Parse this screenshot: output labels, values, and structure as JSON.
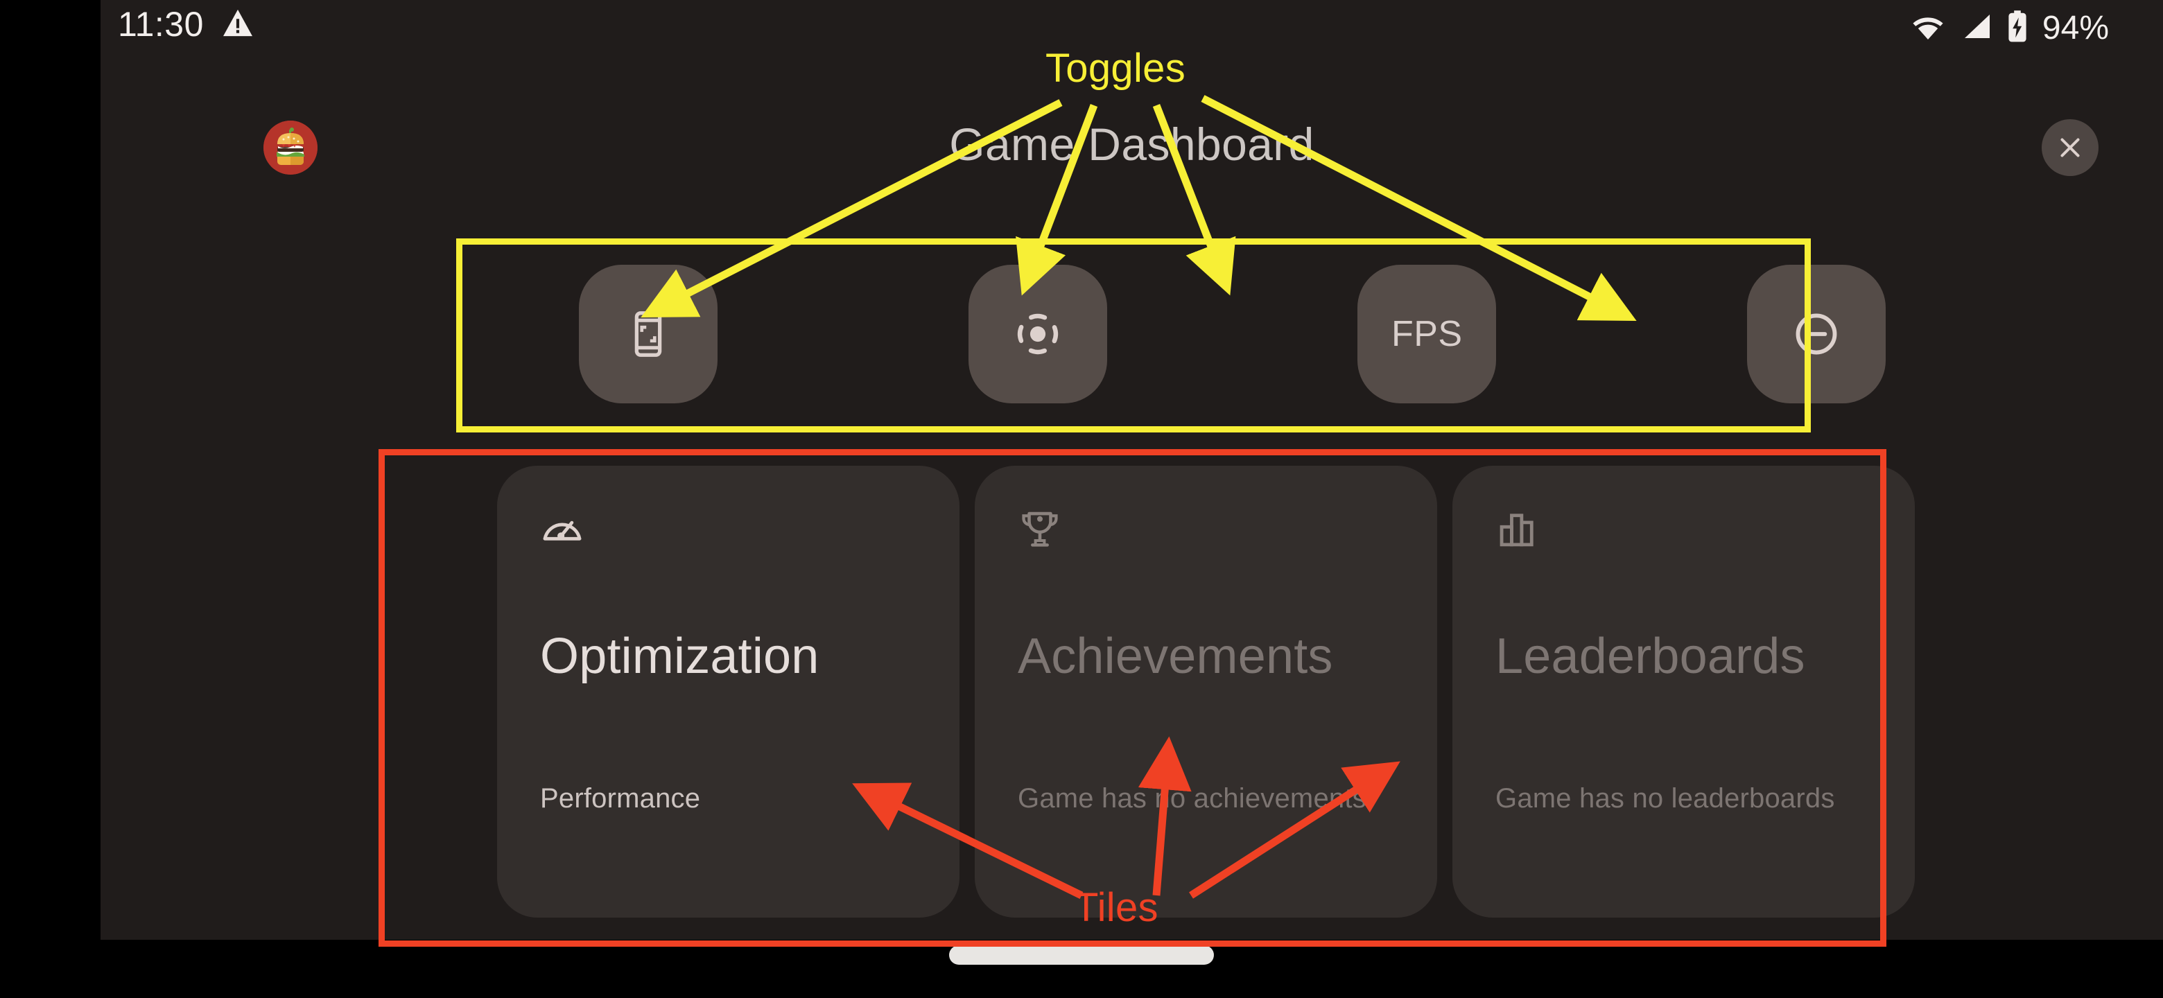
{
  "status_bar": {
    "clock": "11:30",
    "warning_icon": "warning-triangle-icon",
    "wifi_icon": "wifi-icon",
    "signal_icon": "cellular-signal-icon",
    "battery_icon": "battery-charging-icon",
    "battery_level": "94%"
  },
  "header": {
    "app_icon": "burger-app-icon",
    "title": "Game Dashboard",
    "close_label": "close-icon"
  },
  "toggles": [
    {
      "id": "screenshot",
      "icon": "screenshot-icon",
      "label": ""
    },
    {
      "id": "record",
      "icon": "screen-record-icon",
      "label": ""
    },
    {
      "id": "fps",
      "icon": "fps-text",
      "label": "FPS"
    },
    {
      "id": "do-not-disturb",
      "icon": "do-not-disturb-icon",
      "label": ""
    }
  ],
  "tiles": [
    {
      "id": "optimization",
      "icon": "speedometer-icon",
      "title": "Optimization",
      "subtitle": "Performance",
      "disabled": false
    },
    {
      "id": "achievements",
      "icon": "trophy-icon",
      "title": "Achievements",
      "subtitle": "Game has no achievements",
      "disabled": true
    },
    {
      "id": "leaderboards",
      "icon": "bar-chart-icon",
      "title": "Leaderboards",
      "subtitle": "Game has no leaderboards",
      "disabled": true
    }
  ],
  "annotations": {
    "toggles_label": "Toggles",
    "tiles_label": "Tiles",
    "yellow_color": "#f7ef36",
    "red_color": "#f04124"
  },
  "system": {
    "home_indicator": "home-indicator"
  }
}
